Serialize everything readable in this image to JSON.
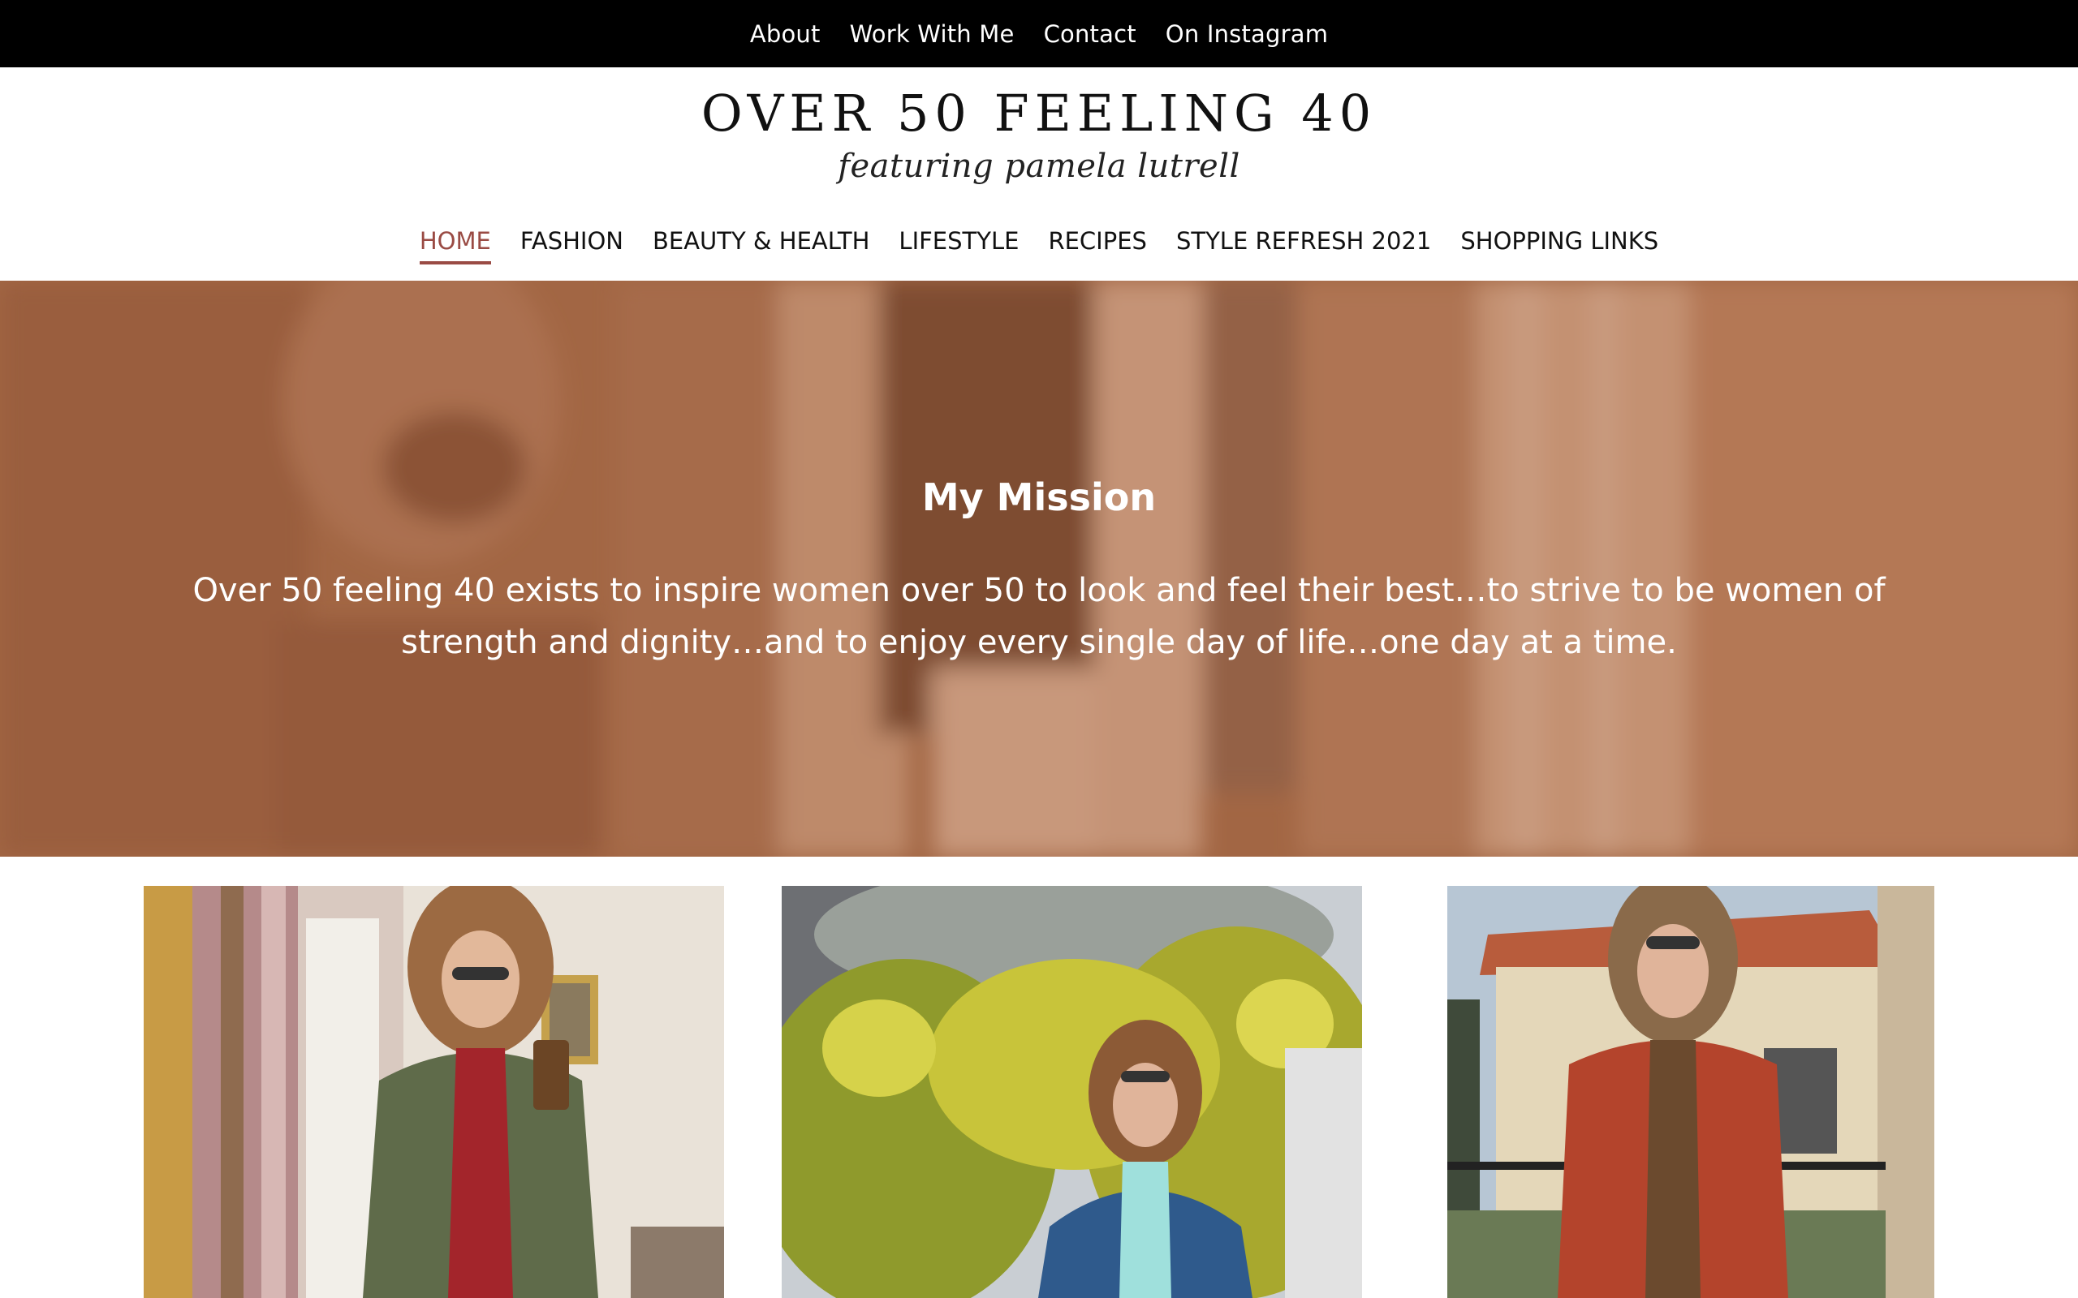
{
  "topbar": {
    "links": [
      "About",
      "Work With Me",
      "Contact",
      "On Instagram"
    ]
  },
  "logo": {
    "title": "OVER 50 FEELING 40",
    "subtitle": "featuring pamela lutrell"
  },
  "mainnav": {
    "items": [
      "HOME",
      "FASHION",
      "BEAUTY & HEALTH",
      "LIFESTYLE",
      "RECIPES",
      "STYLE REFRESH 2021",
      "SHOPPING LINKS"
    ],
    "active": "HOME"
  },
  "hero": {
    "title": "My Mission",
    "text": "Over 50 feeling 40 exists to inspire women over 50 to look and feel their best…to strive to be women of strength and dignity…and to enjoy every single day of life…one day at a time."
  },
  "colors": {
    "accent": "#9a4b44",
    "hero_tint": "#a8704e",
    "topbar": "#000000"
  },
  "posts": [
    {
      "image": "woman in green jacket taking mirror selfie with phone"
    },
    {
      "image": "woman in denim jacket in front of yellow flowering bush"
    },
    {
      "image": "woman in rust cardigan and leopard top outside stone building"
    }
  ]
}
